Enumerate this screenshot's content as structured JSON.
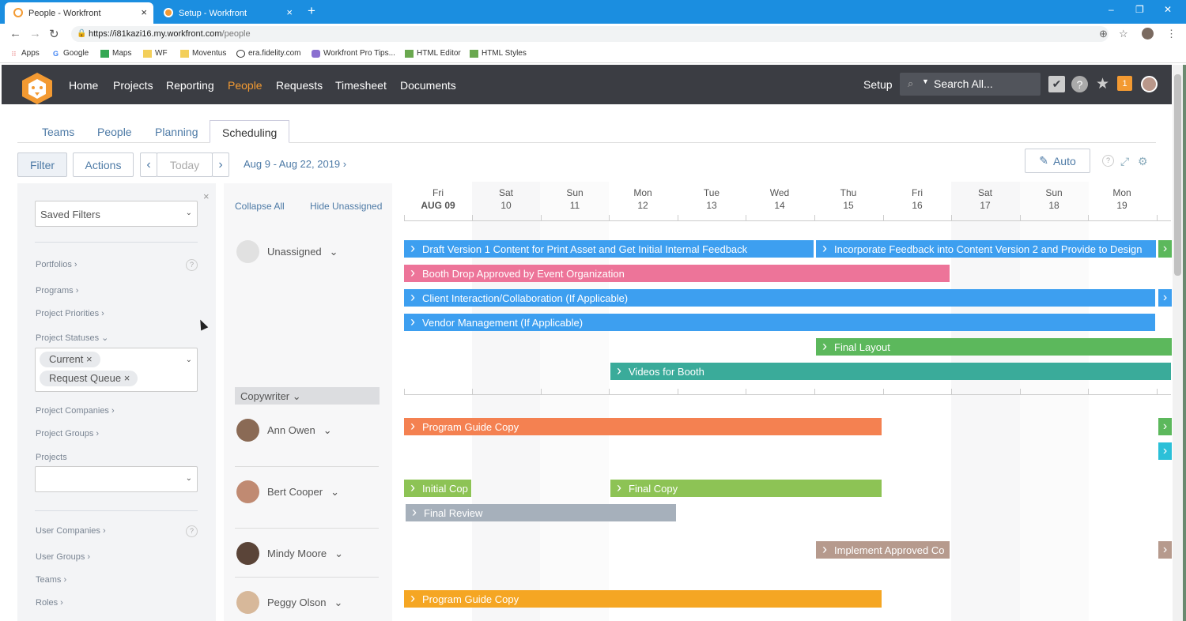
{
  "browser": {
    "tabs": [
      {
        "label": "People - Workfront"
      },
      {
        "label": "Setup - Workfront"
      }
    ],
    "url_domain": "https://i81kazi16.my.workfront.com",
    "url_path": "/people",
    "window_controls": [
      "–",
      "❐",
      "✕"
    ],
    "bookmarks": [
      "Apps",
      "Google",
      "Maps",
      "WF",
      "Moventus",
      "era.fidelity.com",
      "Workfront Pro Tips...",
      "HTML Editor",
      "HTML Styles"
    ]
  },
  "header": {
    "nav": [
      "Home",
      "Projects",
      "Reporting",
      "People",
      "Requests",
      "Timesheet",
      "Documents"
    ],
    "active_nav": "People",
    "setup": "Setup",
    "search_placeholder": "Search All...",
    "notification_count": "1",
    "accent_color": "#f39a32"
  },
  "subtabs": [
    "Teams",
    "People",
    "Planning",
    "Scheduling"
  ],
  "active_subtab": "Scheduling",
  "toolbar": {
    "filter": "Filter",
    "actions": "Actions",
    "today": "Today",
    "date_range": "Aug 9 - Aug 22, 2019",
    "auto": "Auto"
  },
  "filters": {
    "saved_filters": "Saved Filters",
    "labels": {
      "portfolios": "Portfolios",
      "programs": "Programs",
      "project_priorities": "Project Priorities",
      "project_statuses": "Project Statuses",
      "project_companies": "Project Companies",
      "project_groups": "Project Groups",
      "projects": "Projects",
      "user_companies": "User Companies",
      "user_groups": "User Groups",
      "teams": "Teams",
      "roles": "Roles"
    },
    "status_chips": [
      "Current",
      "Request Queue"
    ]
  },
  "people_panel": {
    "collapse_all": "Collapse All",
    "hide_unassigned": "Hide Unassigned",
    "unassigned": "Unassigned",
    "role": "Copywriter",
    "people": [
      "Ann Owen",
      "Bert Cooper",
      "Mindy Moore",
      "Peggy Olson"
    ]
  },
  "calendar": {
    "days": [
      {
        "dow": "Fri",
        "date": "AUG 09"
      },
      {
        "dow": "Sat",
        "date": "10"
      },
      {
        "dow": "Sun",
        "date": "11"
      },
      {
        "dow": "Mon",
        "date": "12"
      },
      {
        "dow": "Tue",
        "date": "13"
      },
      {
        "dow": "Wed",
        "date": "14"
      },
      {
        "dow": "Thu",
        "date": "15"
      },
      {
        "dow": "Fri",
        "date": "16"
      },
      {
        "dow": "Sat",
        "date": "17"
      },
      {
        "dow": "Sun",
        "date": "18"
      },
      {
        "dow": "Mon",
        "date": "19"
      }
    ],
    "tasks": [
      {
        "name": "Draft Version 1 Content for Print Asset and Get Initial Internal Feedback",
        "color": "#3d9ff0",
        "assignee": "Unassigned"
      },
      {
        "name": "Incorporate Feedback into Content Version 2 and Provide to Design",
        "color": "#3d9ff0",
        "assignee": "Unassigned"
      },
      {
        "name": "Booth Drop Approved by Event Organization",
        "color": "#ed7499",
        "assignee": "Unassigned"
      },
      {
        "name": "Client Interaction/Collaboration (If Applicable)",
        "color": "#3d9ff0",
        "assignee": "Unassigned"
      },
      {
        "name": "Vendor Management (If Applicable)",
        "color": "#3d9ff0",
        "assignee": "Unassigned"
      },
      {
        "name": "Final Layout",
        "color": "#5cb85c",
        "assignee": "Unassigned"
      },
      {
        "name": "Videos for Booth",
        "color": "#3aab9a",
        "assignee": "Unassigned"
      },
      {
        "name": "Program Guide Copy",
        "color": "#f48151",
        "assignee": "Ann Owen"
      },
      {
        "name": "Initial Cop",
        "color": "#8dc355",
        "assignee": "Bert Cooper"
      },
      {
        "name": "Final Copy",
        "color": "#8dc355",
        "assignee": "Bert Cooper"
      },
      {
        "name": "Final Review",
        "color": "#a6b0bb",
        "assignee": "Bert Cooper"
      },
      {
        "name": "Implement Approved Co",
        "color": "#b69a8d",
        "assignee": "Mindy Moore"
      },
      {
        "name": "Program Guide Copy",
        "color": "#f5a623",
        "assignee": "Peggy Olson"
      }
    ],
    "stubs": [
      {
        "color": "#5cb85c"
      },
      {
        "color": "#3d9ff0"
      },
      {
        "color": "#5cb85c"
      },
      {
        "color": "#2bc0d8"
      },
      {
        "color": "#b69a8d"
      }
    ]
  }
}
